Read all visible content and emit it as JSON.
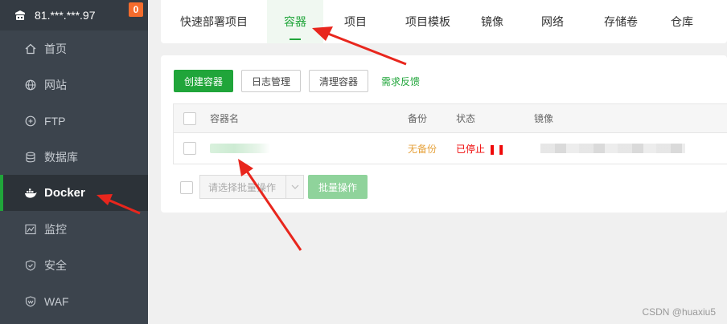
{
  "sidebar": {
    "server": "81.***.***.97",
    "badge": "0",
    "items": [
      {
        "label": "首页",
        "icon": "home-icon"
      },
      {
        "label": "网站",
        "icon": "globe-icon"
      },
      {
        "label": "FTP",
        "icon": "ftp-icon"
      },
      {
        "label": "数据库",
        "icon": "database-icon"
      },
      {
        "label": "Docker",
        "icon": "docker-icon"
      },
      {
        "label": "监控",
        "icon": "monitor-icon"
      },
      {
        "label": "安全",
        "icon": "shield-icon"
      },
      {
        "label": "WAF",
        "icon": "waf-shield-icon"
      }
    ]
  },
  "tabs": [
    "快速部署项目",
    "容器",
    "项目",
    "项目模板",
    "镜像",
    "网络",
    "存储卷",
    "仓库"
  ],
  "toolbar": {
    "create": "创建容器",
    "logs": "日志管理",
    "clean": "清理容器",
    "feedback": "需求反馈"
  },
  "table": {
    "headers": {
      "name": "容器名",
      "backup": "备份",
      "status": "状态",
      "image": "镜像"
    },
    "rows": [
      {
        "backup": "无备份",
        "status": "已停止",
        "status_icon": "pause-icon"
      }
    ]
  },
  "batch": {
    "placeholder": "请选择批量操作",
    "button": "批量操作"
  },
  "watermark": "CSDN @huaxiu5",
  "colors": {
    "accent": "#20a53a",
    "sidebar": "#3c444d",
    "stopped": "#ef0808",
    "warning": "#e6a23c",
    "annotation_arrow": "#e8261d"
  }
}
